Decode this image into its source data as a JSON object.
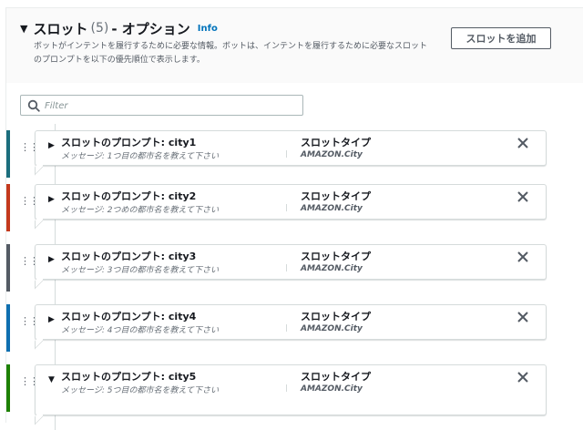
{
  "section": {
    "caret": "▼",
    "title": "スロット",
    "count": "(5)",
    "title_suffix": "- オプション",
    "info": "Info",
    "description": "ボットがインテントを履行するために必要な情報。ボットは、インテントを履行するために必要なスロットのプロンプトを以下の優先順位で表示します。",
    "add_button": "スロットを追加"
  },
  "filter": {
    "placeholder": "Filter"
  },
  "colors": {
    "stripe_1": "#1b6e7d",
    "stripe_2": "#c4391d",
    "stripe_3": "#545b64",
    "stripe_4": "#0f6fb0",
    "stripe_5": "#1d8102",
    "link": "#0073bb"
  },
  "slots": [
    {
      "expand": "▶",
      "prompt": "スロットのプロンプト: city1",
      "message": "メッセージ: 1つ目の都市名を教えて下さい",
      "type_label": "スロットタイプ",
      "type_value": "AMAZON.City"
    },
    {
      "expand": "▶",
      "prompt": "スロットのプロンプト: city2",
      "message": "メッセージ: 2つめの都市名を教えて下さい",
      "type_label": "スロットタイプ",
      "type_value": "AMAZON.City"
    },
    {
      "expand": "▶",
      "prompt": "スロットのプロンプト: city3",
      "message": "メッセージ: 3つ目の都市名を教えて下さい",
      "type_label": "スロットタイプ",
      "type_value": "AMAZON.City"
    },
    {
      "expand": "▶",
      "prompt": "スロットのプロンプト: city4",
      "message": "メッセージ: 4つ目の都市名を教えて下さい",
      "type_label": "スロットタイプ",
      "type_value": "AMAZON.City"
    },
    {
      "expand": "▼",
      "prompt": "スロットのプロンプト: city5",
      "message": "メッセージ: 5つ目の都市名を教えて下さい",
      "type_label": "スロットタイプ",
      "type_value": "AMAZON.City"
    }
  ]
}
